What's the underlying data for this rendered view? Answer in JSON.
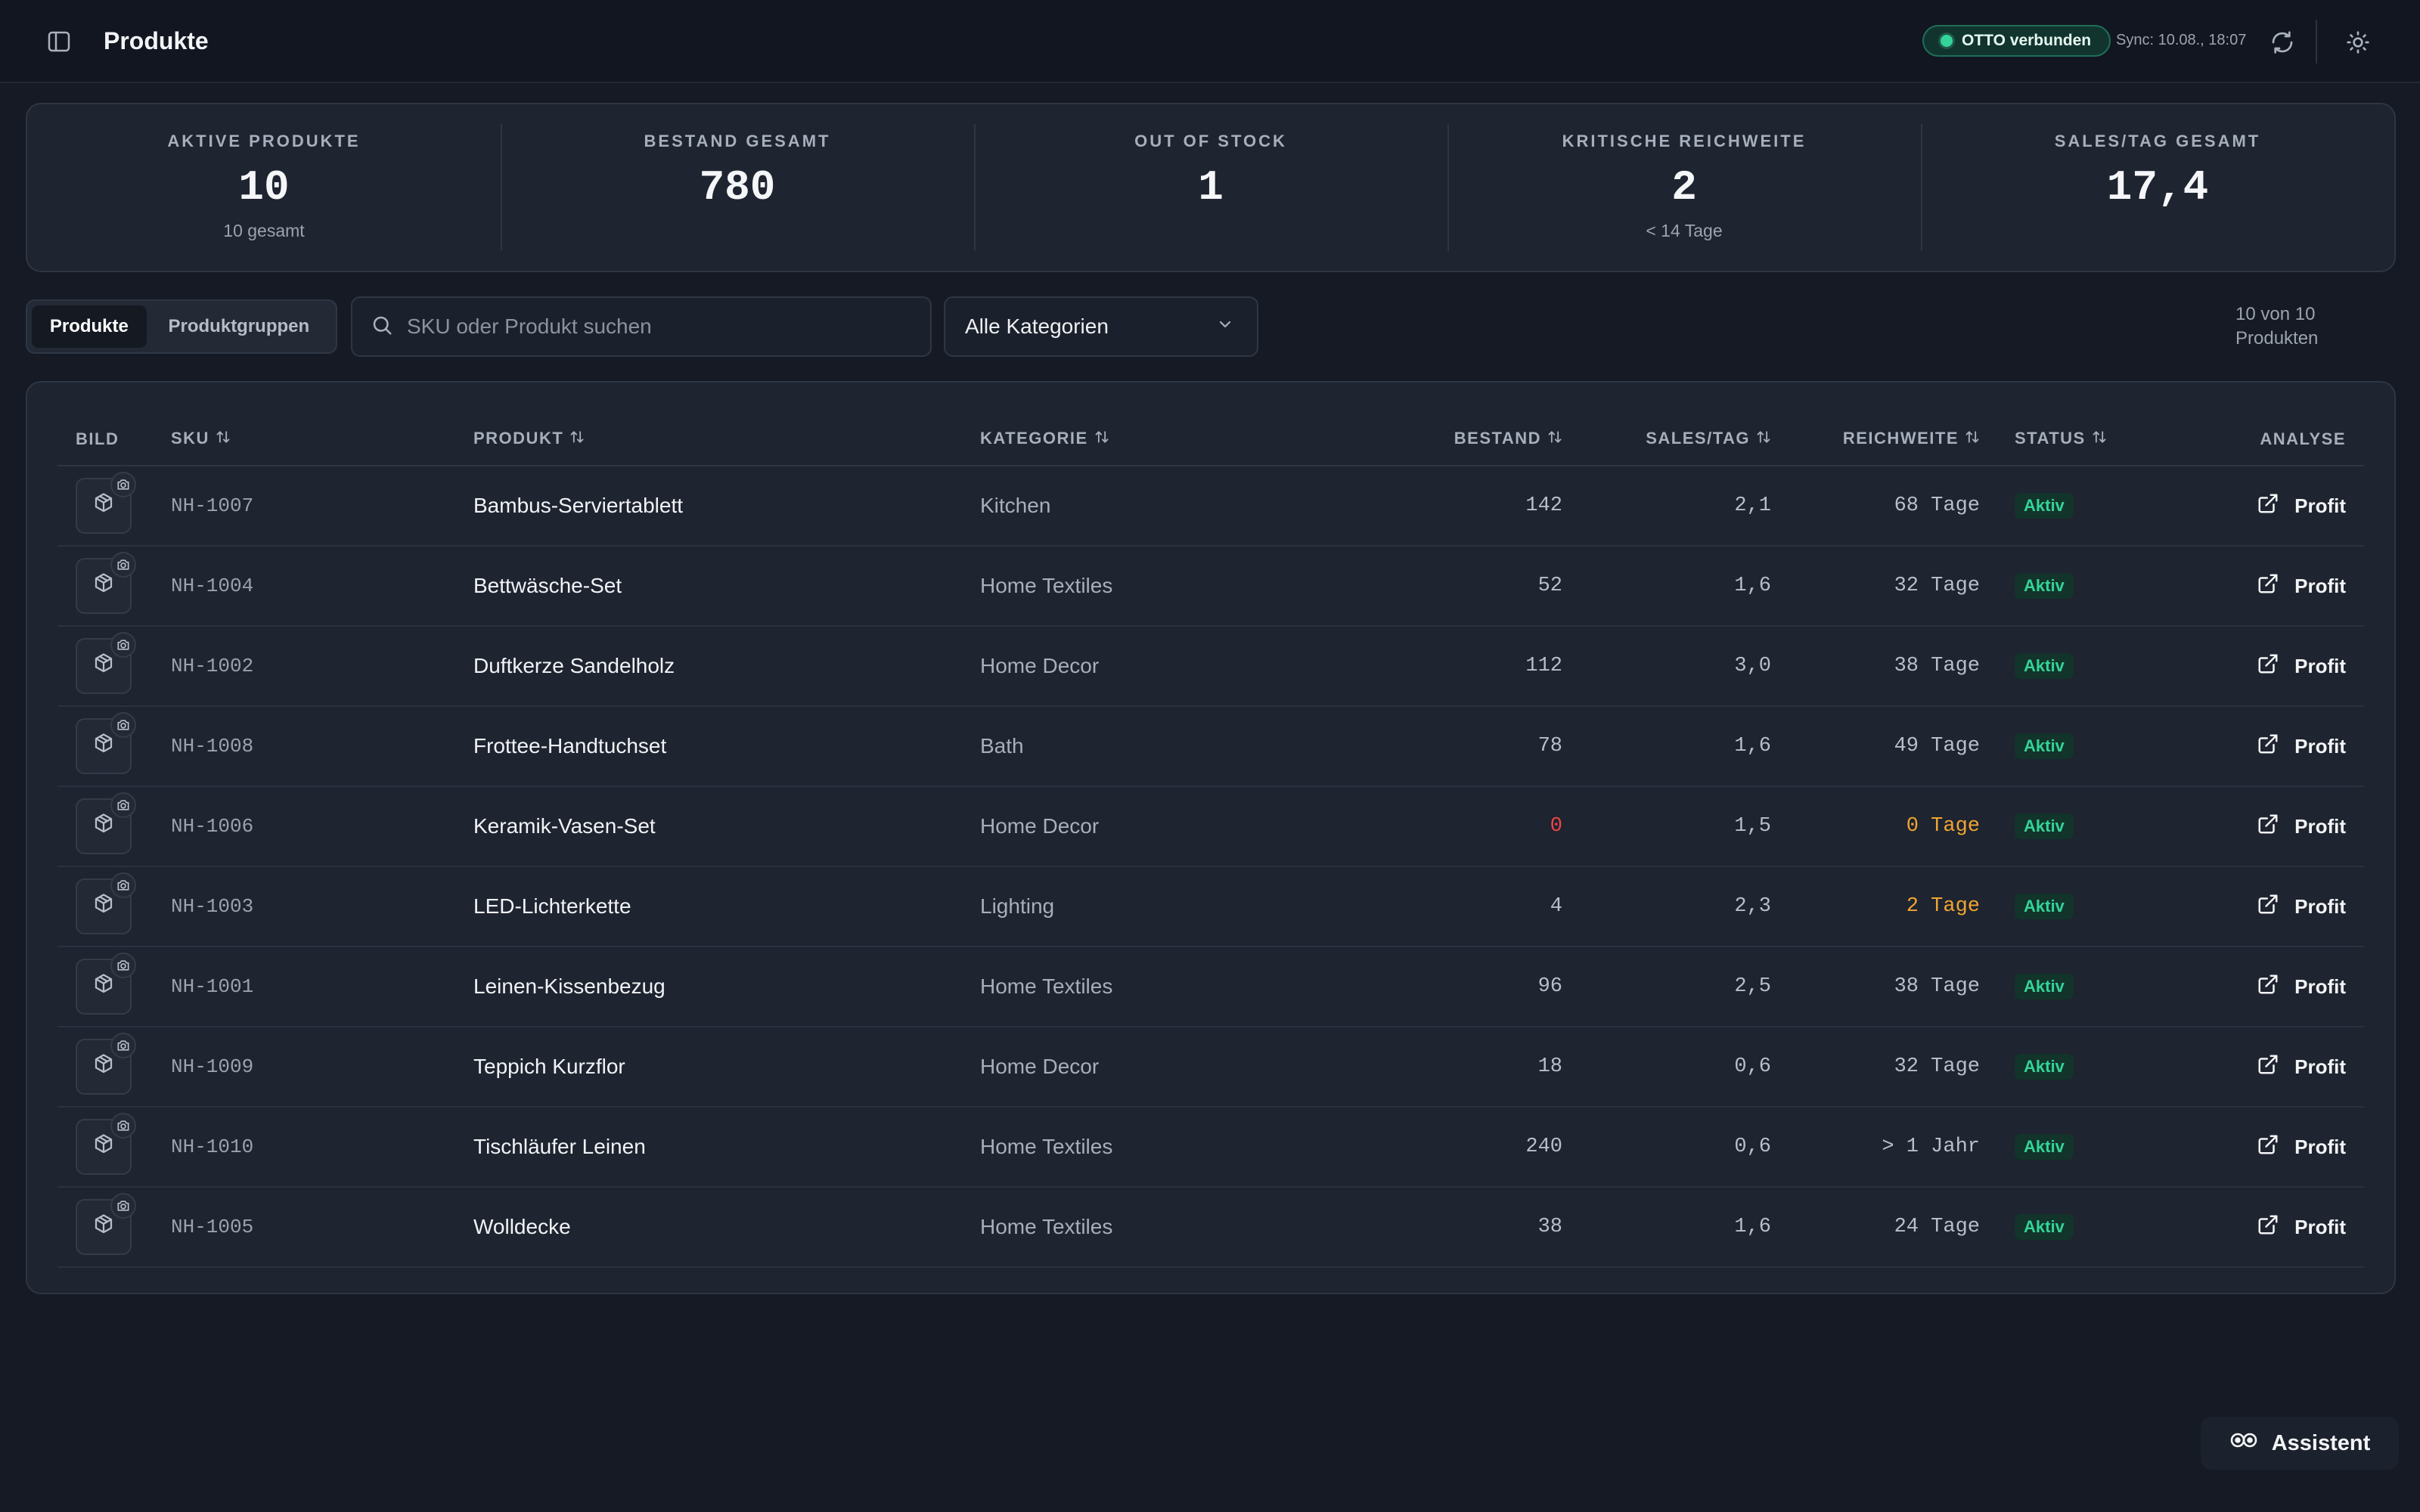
{
  "header": {
    "title": "Produkte",
    "connection_label": "OTTO verbunden",
    "sync_text": "Sync: 10.08., 18:07"
  },
  "kpis": [
    {
      "label": "AKTIVE PRODUKTE",
      "value": "10",
      "sub": "10 gesamt"
    },
    {
      "label": "BESTAND GESAMT",
      "value": "780",
      "sub": ""
    },
    {
      "label": "OUT OF STOCK",
      "value": "1",
      "sub": ""
    },
    {
      "label": "KRITISCHE REICHWEITE",
      "value": "2",
      "sub": "< 14 Tage"
    },
    {
      "label": "SALES/TAG GESAMT",
      "value": "17,4",
      "sub": ""
    }
  ],
  "toolbar": {
    "tab_products": "Produkte",
    "tab_groups": "Produktgruppen",
    "search_placeholder": "SKU oder Produkt suchen",
    "category_selected": "Alle Kategorien",
    "count_text": "10 von 10 Produkten"
  },
  "table": {
    "columns": {
      "bild": "BILD",
      "sku": "SKU",
      "produkt": "PRODUKT",
      "kategorie": "KATEGORIE",
      "bestand": "BESTAND",
      "sales": "SALES/TAG",
      "reichweite": "REICHWEITE",
      "status": "STATUS",
      "analyse": "ANALYSE"
    },
    "rows": [
      {
        "sku": "NH-1007",
        "product": "Bambus-Serviertablett",
        "category": "Kitchen",
        "stock": "142",
        "sales": "2,1",
        "reach": "68 Tage",
        "status": "Aktiv",
        "action": "Profit"
      },
      {
        "sku": "NH-1004",
        "product": "Bettwäsche-Set",
        "category": "Home Textiles",
        "stock": "52",
        "sales": "1,6",
        "reach": "32 Tage",
        "status": "Aktiv",
        "action": "Profit"
      },
      {
        "sku": "NH-1002",
        "product": "Duftkerze Sandelholz",
        "category": "Home Decor",
        "stock": "112",
        "sales": "3,0",
        "reach": "38 Tage",
        "status": "Aktiv",
        "action": "Profit"
      },
      {
        "sku": "NH-1008",
        "product": "Frottee-Handtuchset",
        "category": "Bath",
        "stock": "78",
        "sales": "1,6",
        "reach": "49 Tage",
        "status": "Aktiv",
        "action": "Profit"
      },
      {
        "sku": "NH-1006",
        "product": "Keramik-Vasen-Set",
        "category": "Home Decor",
        "stock": "0",
        "sales": "1,5",
        "reach": "0 Tage",
        "status": "Aktiv",
        "action": "Profit"
      },
      {
        "sku": "NH-1003",
        "product": "LED-Lichterkette",
        "category": "Lighting",
        "stock": "4",
        "sales": "2,3",
        "reach": "2 Tage",
        "status": "Aktiv",
        "action": "Profit"
      },
      {
        "sku": "NH-1001",
        "product": "Leinen-Kissenbezug",
        "category": "Home Textiles",
        "stock": "96",
        "sales": "2,5",
        "reach": "38 Tage",
        "status": "Aktiv",
        "action": "Profit"
      },
      {
        "sku": "NH-1009",
        "product": "Teppich Kurzflor",
        "category": "Home Decor",
        "stock": "18",
        "sales": "0,6",
        "reach": "32 Tage",
        "status": "Aktiv",
        "action": "Profit"
      },
      {
        "sku": "NH-1010",
        "product": "Tischläufer Leinen",
        "category": "Home Textiles",
        "stock": "240",
        "sales": "0,6",
        "reach": "> 1 Jahr",
        "status": "Aktiv",
        "action": "Profit"
      },
      {
        "sku": "NH-1005",
        "product": "Wolldecke",
        "category": "Home Textiles",
        "stock": "38",
        "sales": "1,6",
        "reach": "24 Tage",
        "status": "Aktiv",
        "action": "Profit"
      }
    ]
  },
  "assistant_label": "Assistent",
  "colors": {
    "background": "#151a24",
    "panel": "#1e2430",
    "accent_green": "#34d399",
    "danger_red": "#ef4444",
    "warning_amber": "#f0a531"
  }
}
